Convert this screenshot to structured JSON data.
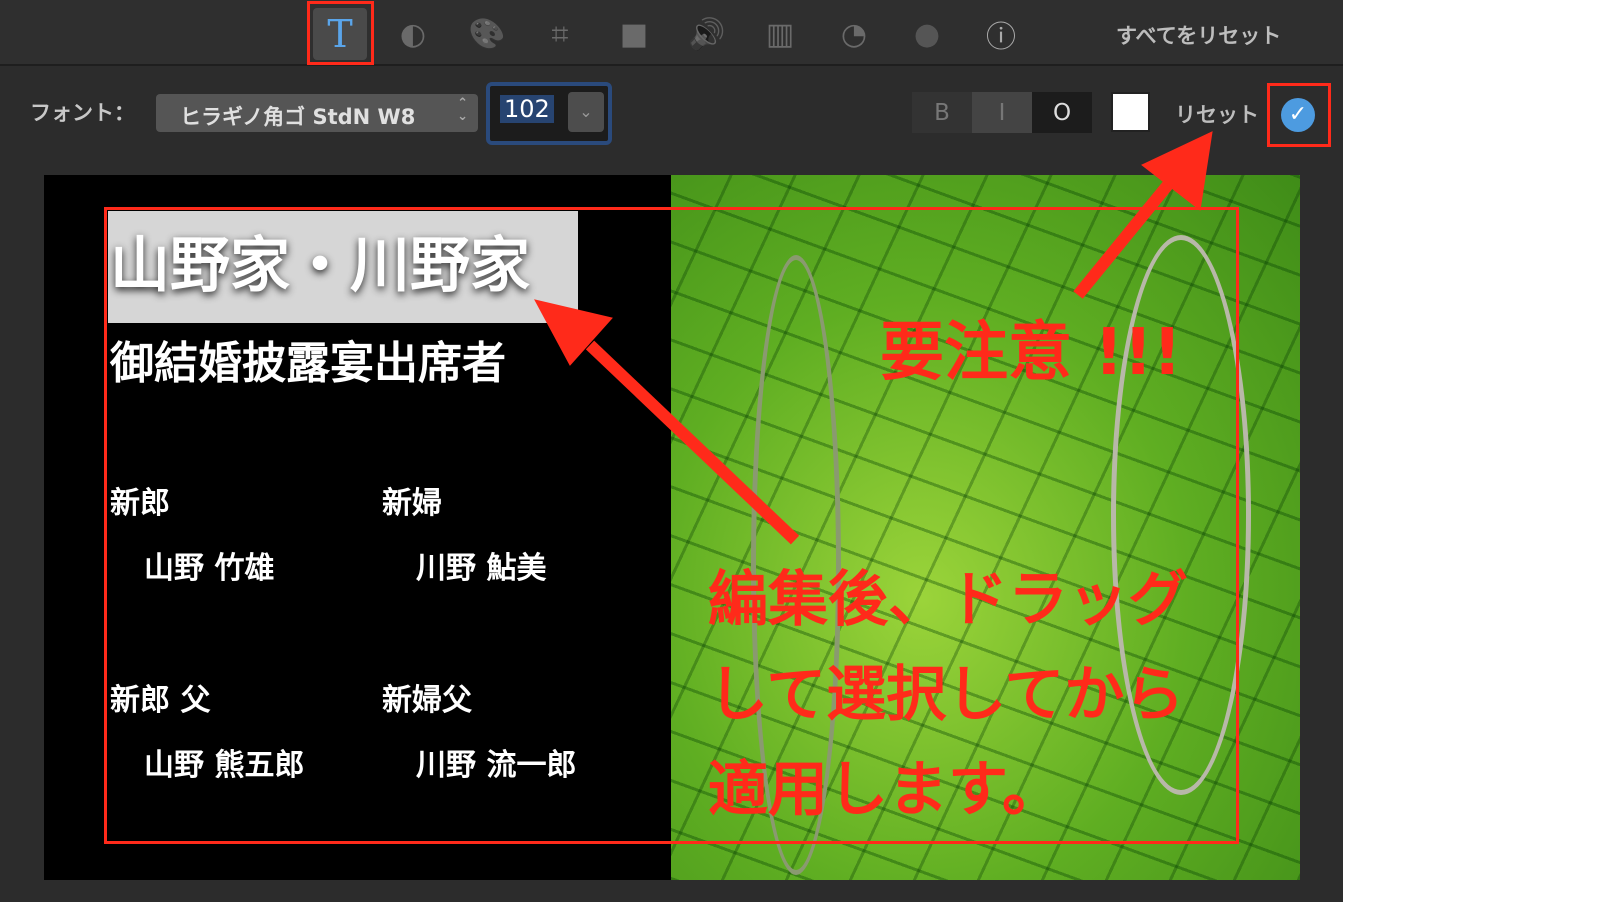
{
  "toolbar": {
    "tools": [
      {
        "name": "text-icon",
        "glyph": "T"
      },
      {
        "name": "color-balance-icon",
        "glyph": "◐"
      },
      {
        "name": "palette-icon",
        "glyph": "🎨"
      },
      {
        "name": "crop-icon",
        "glyph": "⌗"
      },
      {
        "name": "stabilization-icon",
        "glyph": "■"
      },
      {
        "name": "volume-icon",
        "glyph": "🔊"
      },
      {
        "name": "equalizer-icon",
        "glyph": "▥"
      },
      {
        "name": "speed-icon",
        "glyph": "◔"
      },
      {
        "name": "filter-icon",
        "glyph": "●"
      },
      {
        "name": "info-icon",
        "glyph": "ⓘ"
      }
    ],
    "reset_all": "すべてをリセット"
  },
  "format": {
    "font_label": "フォント：",
    "font_value": "ヒラギノ角ゴ StdN W8",
    "size_value": "102",
    "bold": "B",
    "italic": "I",
    "outline": "O",
    "text_color": "#ffffff",
    "reset": "リセット",
    "apply_glyph": "✓"
  },
  "preview": {
    "title": "山野家・川野家",
    "subtitle": "御結婚披露宴出席者",
    "groom_label": "新郎",
    "groom_name": "山野 竹雄",
    "bride_label": "新婦",
    "bride_name": "川野 鮎美",
    "groom_father_label": "新郎 父",
    "groom_father_name": "山野 熊五郎",
    "bride_father_label": "新婦父",
    "bride_father_name": "川野 流一郎"
  },
  "annotations": {
    "warning": "要注意 !!!",
    "instruction_lines": [
      "編集後、ドラッグ",
      "して選択してから",
      "適用します。"
    ]
  },
  "colors": {
    "accent": "#4d9be0",
    "highlight": "#ff2a1a"
  }
}
